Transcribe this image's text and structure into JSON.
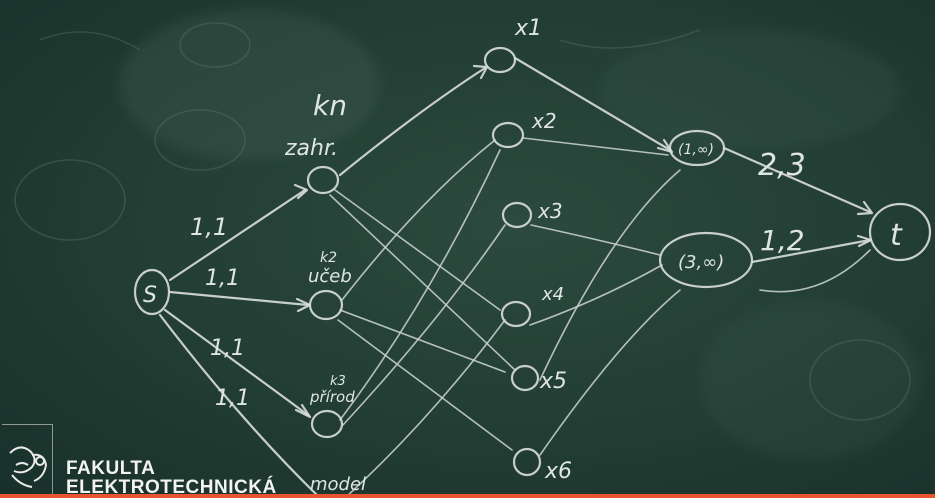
{
  "logo": {
    "line1": "FAKULTA",
    "line2": "ELEKTROTECHNICKÁ"
  },
  "board": {
    "source_label": "S",
    "sink_label": "t",
    "top_labels": [
      "kn",
      "zahr."
    ],
    "mid_labels": [
      "k2",
      "učeb"
    ],
    "low_labels": [
      "k3",
      "přírod"
    ],
    "bottom_label": "model",
    "x_labels": [
      "x1",
      "x2",
      "x3",
      "x4",
      "x5",
      "x6"
    ],
    "edge_labels_left": [
      "1,1",
      "1,1",
      "1,1",
      "1,1"
    ],
    "hub_labels": [
      "(1,∞)",
      "(3,∞)"
    ],
    "edge_labels_right": [
      "2,3",
      "1,2"
    ]
  },
  "colors": {
    "board": "#223d33",
    "chalk": "#d9dede",
    "accent_bar": "#e8552f"
  }
}
